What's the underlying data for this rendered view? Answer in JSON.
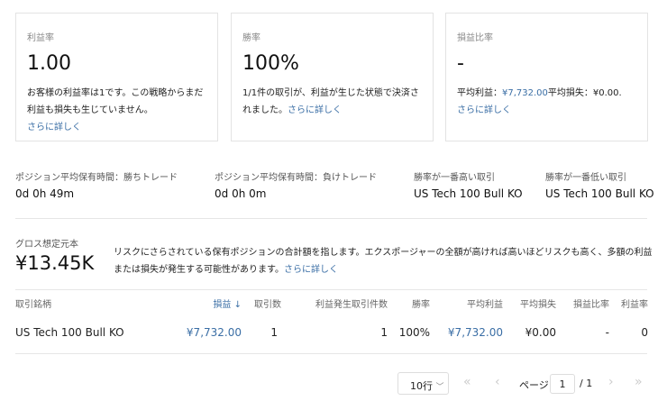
{
  "cards": [
    {
      "label": "利益率",
      "value": "1.00",
      "desc": "お客様の利益率は1です。この戦略からまだ利益も損失も生じていません。",
      "link": "さらに詳しく"
    },
    {
      "label": "勝率",
      "value": "100%",
      "desc": "1/1件の取引が、利益が生じた状態で決済されました。",
      "link": "さらに詳しく"
    },
    {
      "label": "損益比率",
      "value": "-",
      "desc_prefix": "平均利益：",
      "avg_profit": "¥7,732.00",
      "desc_mid": "平均損失：¥0.00.",
      "link": "さらに詳しく"
    }
  ],
  "stats": [
    {
      "label": "ポジション平均保有時間：勝ちトレード",
      "value": "0d 0h 49m"
    },
    {
      "label": "ポジション平均保有時間：負けトレード",
      "value": "0d 0h 0m"
    },
    {
      "label": "勝率が一番高い取引",
      "value": "US Tech 100 Bull KO"
    },
    {
      "label": "勝率が一番低い取引",
      "value": "US Tech 100 Bull KO"
    }
  ],
  "gross": {
    "label": "グロス想定元本",
    "value": "¥13.45K",
    "desc": "リスクにさらされている保有ポジションの合計額を指します。エクスポージャーの全額が高ければ高いほどリスクも高く、多額の利益または損失が発生する可能性があります。",
    "link": "さらに詳しく"
  },
  "table": {
    "headers": [
      "取引銘柄",
      "損益",
      "取引数",
      "利益発生取引件数",
      "勝率",
      "平均利益",
      "平均損失",
      "損益比率",
      "利益率"
    ],
    "sort_icon": "↓",
    "rows": [
      [
        "US Tech 100 Bull KO",
        "¥7,732.00",
        "1",
        "1",
        "100%",
        "¥7,732.00",
        "¥0.00",
        "-",
        "0"
      ]
    ]
  },
  "pagination": {
    "rows_per_page": "10行",
    "page_label": "ページ",
    "page": "1",
    "total": "/ 1"
  }
}
